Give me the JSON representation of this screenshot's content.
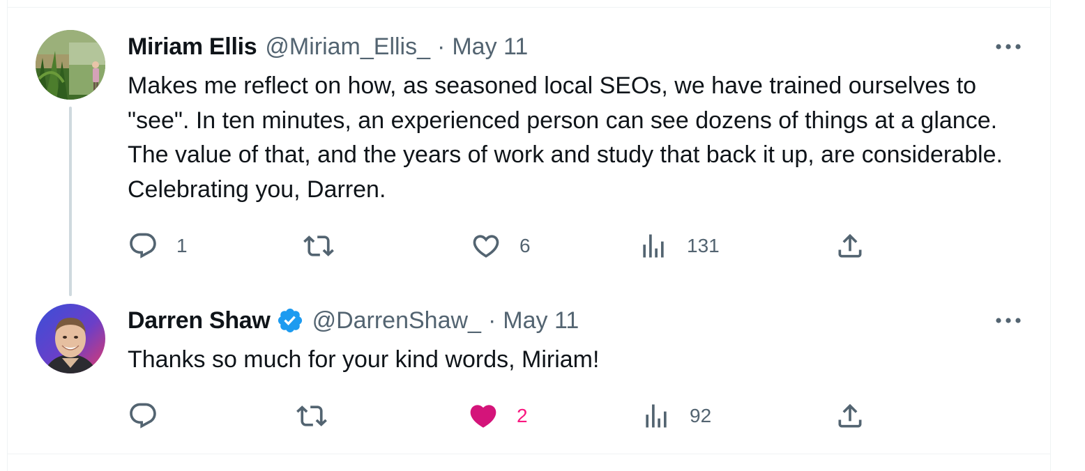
{
  "colors": {
    "text_primary": "#0f1419",
    "text_secondary": "#536471",
    "like_active": "#f91880",
    "verified_badge": "#1d9bf0",
    "thread_line": "#cfd9de"
  },
  "tweets": [
    {
      "author": {
        "name": "Miriam Ellis",
        "handle": "@Miriam_Ellis_",
        "verified": false,
        "avatar_icon": "nature-photo-avatar"
      },
      "separator": "·",
      "date": "May 11",
      "text": "Makes me reflect on how, as seasoned local SEOs, we have trained ourselves to \"see\". In ten minutes, an experienced person can see dozens of things at a glance. The value of that, and the years of work and study that back it up, are considerable. Celebrating you, Darren.",
      "actions": {
        "reply_count": "1",
        "retweet_count": "",
        "like_count": "6",
        "liked": false,
        "views_count": "131"
      }
    },
    {
      "author": {
        "name": "Darren Shaw",
        "handle": "@DarrenShaw_",
        "verified": true,
        "avatar_icon": "person-photo-avatar"
      },
      "separator": "·",
      "date": "May 11",
      "text": "Thanks so much for your kind words, Miriam!",
      "actions": {
        "reply_count": "",
        "retweet_count": "",
        "like_count": "2",
        "liked": true,
        "views_count": "92"
      }
    }
  ]
}
